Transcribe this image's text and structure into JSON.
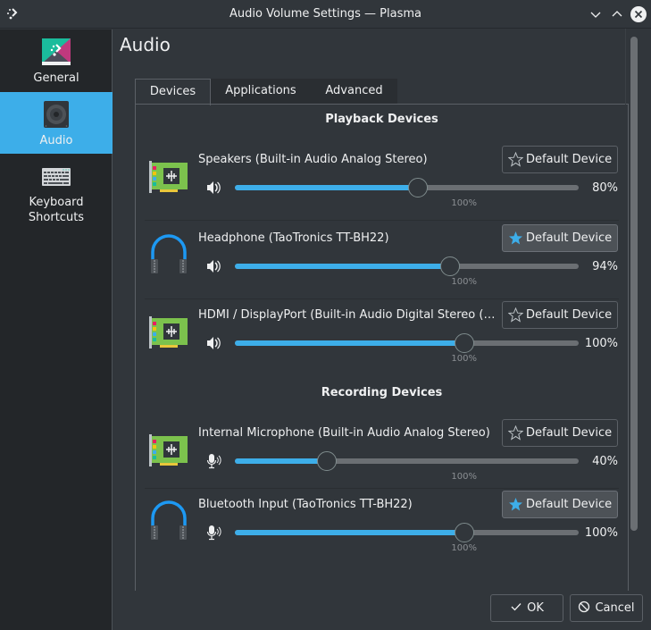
{
  "window": {
    "title": "Audio Volume Settings — Plasma",
    "controls": [
      "minimize-icon",
      "maximize-icon",
      "close-icon"
    ]
  },
  "sidebar": {
    "items": [
      {
        "label": "General",
        "icon": "plasma-logo-icon",
        "active": false
      },
      {
        "label": "Audio",
        "icon": "speaker-device-icon",
        "active": true
      },
      {
        "label": "Keyboard\nShortcuts",
        "label_line1": "Keyboard",
        "label_line2": "Shortcuts",
        "icon": "keyboard-icon",
        "active": false
      }
    ]
  },
  "page": {
    "title": "Audio"
  },
  "tabs": [
    {
      "label": "Devices",
      "active": true
    },
    {
      "label": "Applications",
      "active": false
    },
    {
      "label": "Advanced",
      "active": false
    }
  ],
  "playback": {
    "heading": "Playback Devices",
    "devices": [
      {
        "name": "Speakers (Built-in Audio Analog Stereo)",
        "icon": "sound-card-icon",
        "volume_icon": "speaker-icon",
        "volume_percent": 80,
        "volume_label": "80%",
        "default": false,
        "default_label": "Default Device",
        "tick_label": "100%"
      },
      {
        "name": "Headphone (TaoTronics TT-BH22)",
        "icon": "headphones-icon",
        "volume_icon": "speaker-icon",
        "volume_percent": 94,
        "volume_label": "94%",
        "default": true,
        "default_label": "Default Device",
        "tick_label": "100%"
      },
      {
        "name": "HDMI / DisplayPort (Built-in Audio Digital Stereo (…",
        "icon": "sound-card-icon",
        "volume_icon": "speaker-icon",
        "volume_percent": 100,
        "volume_label": "100%",
        "default": false,
        "default_label": "Default Device",
        "tick_label": "100%"
      }
    ]
  },
  "recording": {
    "heading": "Recording Devices",
    "devices": [
      {
        "name": "Internal Microphone (Built-in Audio Analog Stereo)",
        "icon": "sound-card-icon",
        "volume_icon": "microphone-icon",
        "volume_percent": 40,
        "volume_label": "40%",
        "default": false,
        "default_label": "Default Device",
        "tick_label": "100%"
      },
      {
        "name": "Bluetooth Input (TaoTronics TT-BH22)",
        "icon": "headphones-icon",
        "volume_icon": "microphone-icon",
        "volume_percent": 100,
        "volume_label": "100%",
        "default": true,
        "default_label": "Default Device",
        "tick_label": "100%"
      }
    ]
  },
  "slider_max_percent": 150,
  "footer": {
    "ok_label": "OK",
    "cancel_label": "Cancel"
  },
  "colors": {
    "accent": "#3daee9",
    "window_bg": "#31363b",
    "sidebar_bg": "#232629",
    "text": "#eff0f1"
  }
}
